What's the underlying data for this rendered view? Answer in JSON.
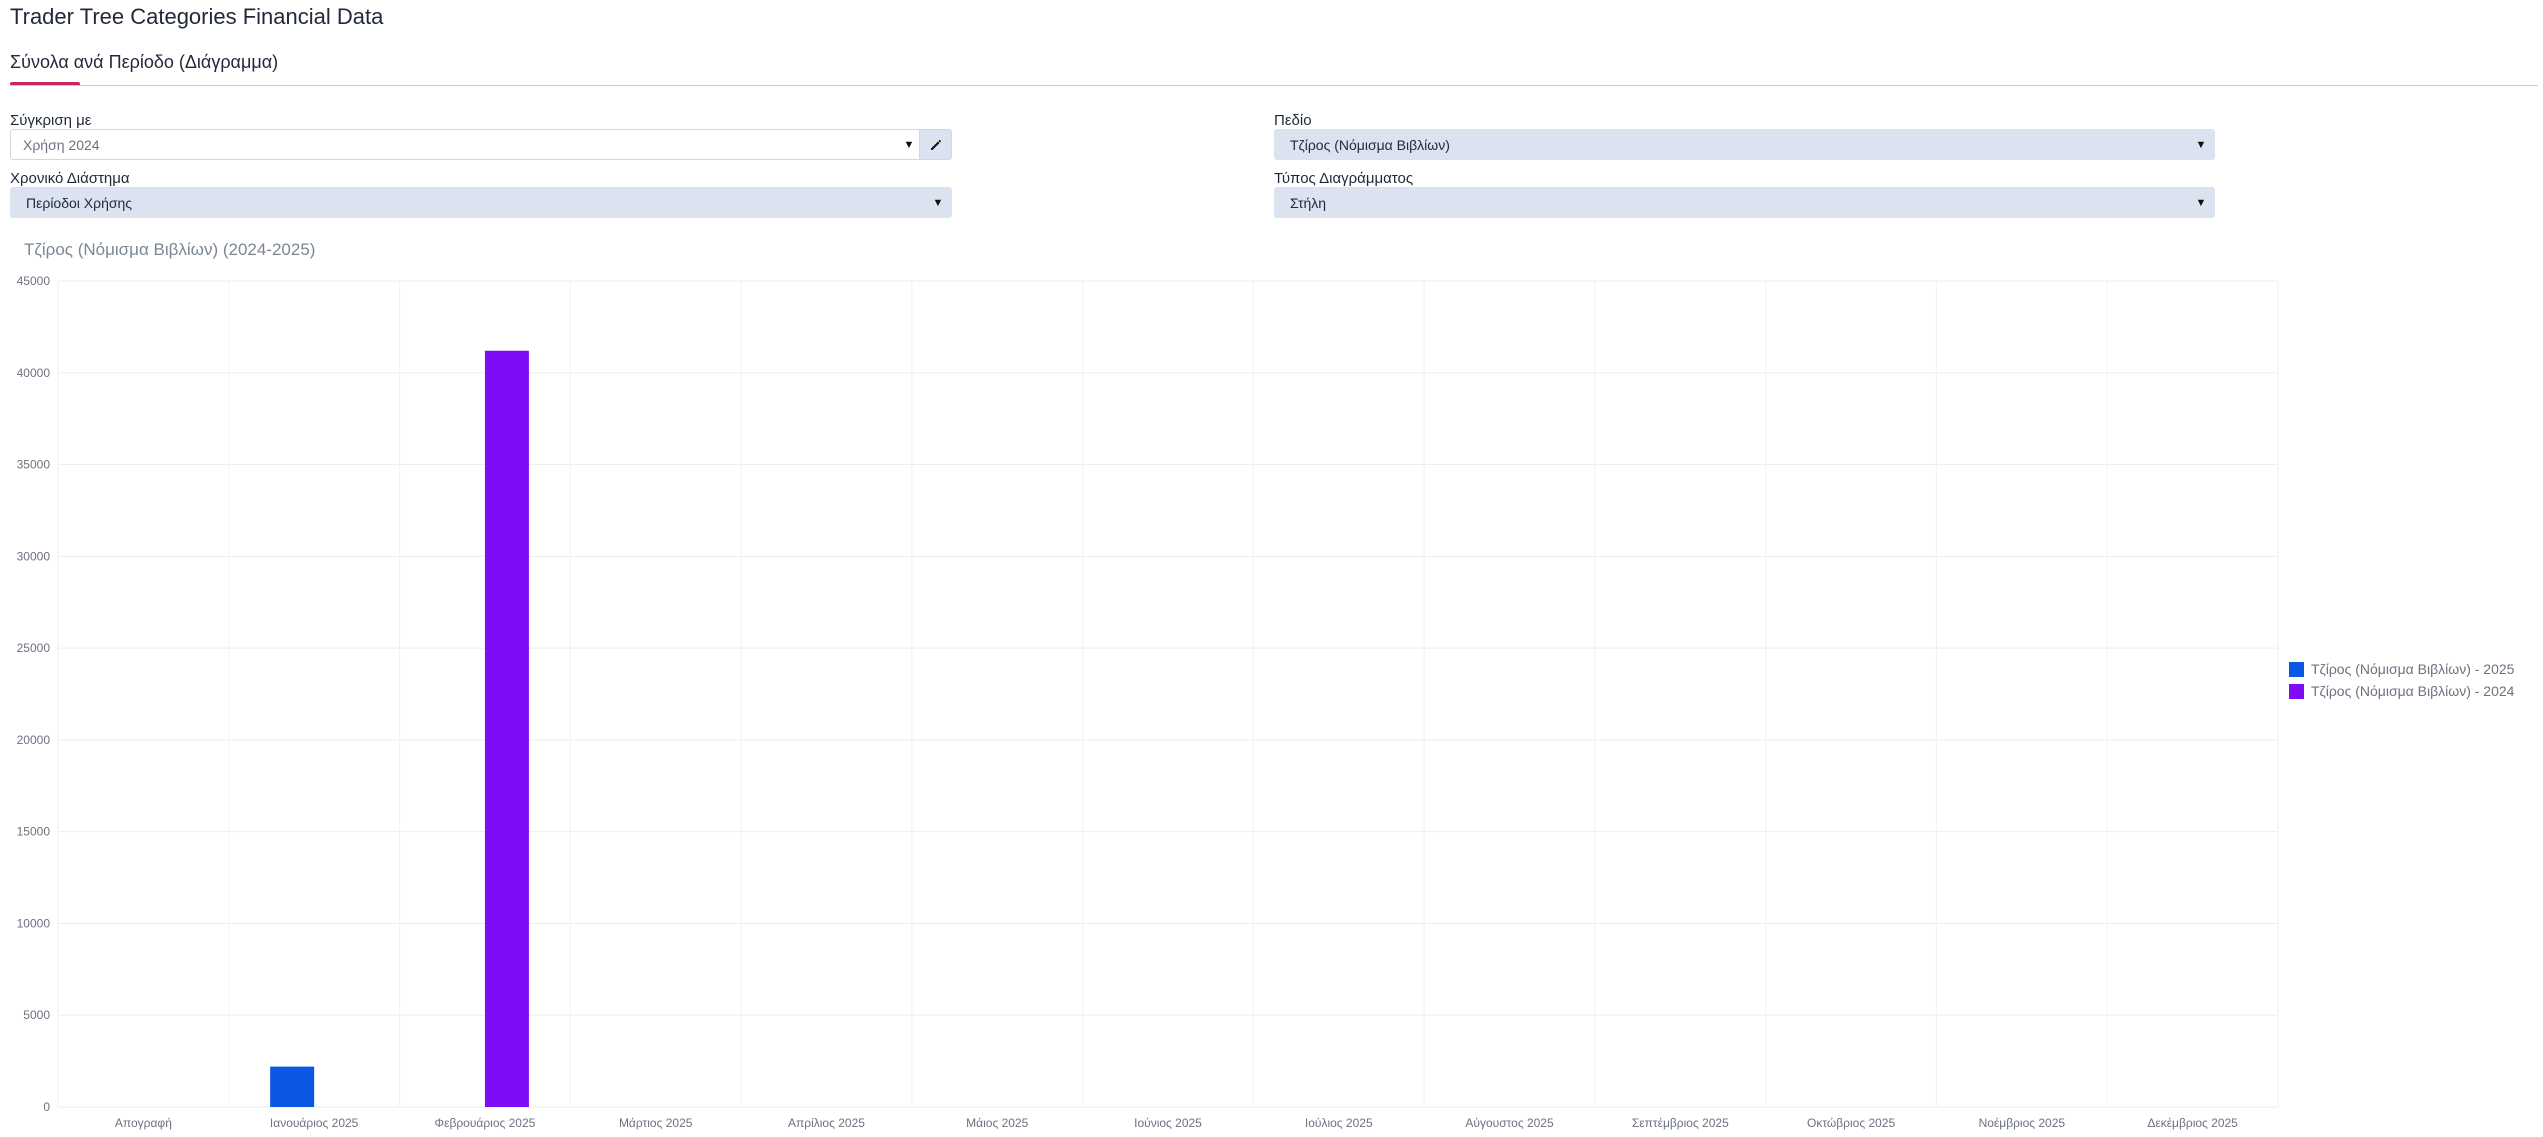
{
  "page": {
    "title": "Trader Tree Categories Financial Data"
  },
  "tab": {
    "label": "Σύνολα ανά Περίοδο (Διάγραμμα)"
  },
  "filters": {
    "compare": {
      "label": "Σύγκριση με",
      "value": "Χρήση 2024",
      "icons": [
        "chevron-down-icon",
        "pencil-icon"
      ]
    },
    "field": {
      "label": "Πεδίο",
      "value": "Τζίρος (Νόμισμα Βιβλίων)"
    },
    "range": {
      "label": "Χρονικό Διάστημα",
      "value": "Περίοδοι Χρήσης"
    },
    "chart_type": {
      "label": "Τύπος Διαγράμματος",
      "value": "Στήλη"
    }
  },
  "colors": {
    "accent": "#c4285c",
    "series_2025": "#0b57e3",
    "series_2024": "#7e0cf5",
    "select_bg": "#dae3ef"
  },
  "chart_data": {
    "type": "bar",
    "title": "Τζίρος (Νόμισμα Βιβλίων) (2024-2025)",
    "categories": [
      "Απογραφή",
      "Ιανουάριος 2025",
      "Φεβρουάριος 2025",
      "Μάρτιος 2025",
      "Απρίλιος 2025",
      "Μάιος 2025",
      "Ιούνιος 2025",
      "Ιούλιος 2025",
      "Αύγουστος 2025",
      "Σεπτέμβριος 2025",
      "Οκτώβριος 2025",
      "Νοέμβριος 2025",
      "Δεκέμβριος 2025"
    ],
    "series": [
      {
        "name": "Τζίρος (Νόμισμα Βιβλίων) - 2025",
        "color": "#0b57e3",
        "values": [
          0,
          2200,
          0,
          0,
          0,
          0,
          0,
          0,
          0,
          0,
          0,
          0,
          0
        ]
      },
      {
        "name": "Τζίρος (Νόμισμα Βιβλίων) - 2024",
        "color": "#7e0cf5",
        "values": [
          0,
          0,
          41200,
          0,
          0,
          0,
          0,
          0,
          0,
          0,
          0,
          0,
          0
        ]
      }
    ],
    "ylim": [
      0,
      45000
    ],
    "yticks": [
      0,
      5000,
      10000,
      15000,
      20000,
      25000,
      30000,
      35000,
      40000,
      45000
    ],
    "grid": true,
    "legend": "right"
  }
}
